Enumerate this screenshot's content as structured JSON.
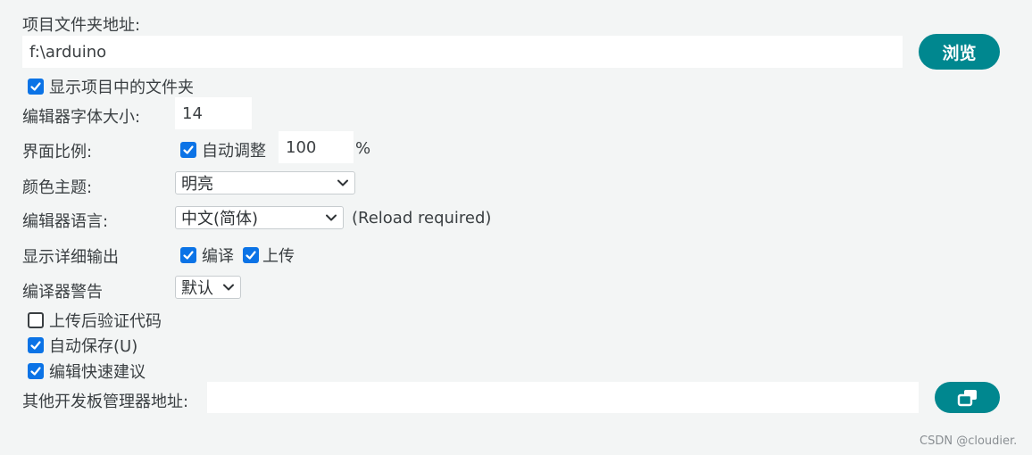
{
  "project_folder": {
    "label": "项目文件夹地址:",
    "value": "f:\\arduino",
    "browse_label": "浏览"
  },
  "show_project_folder": {
    "label": "显示项目中的文件夹",
    "checked": true
  },
  "font_size": {
    "label": "编辑器字体大小:",
    "value": "14"
  },
  "scale": {
    "label": "界面比例:",
    "auto_label": "自动调整",
    "auto_checked": true,
    "value": "100",
    "unit": "%"
  },
  "theme": {
    "label": "颜色主题:",
    "value": "明亮"
  },
  "language": {
    "label": "编辑器语言:",
    "value": "中文(简体)",
    "note": "(Reload required)"
  },
  "verbose": {
    "label": "显示详细输出",
    "compile_label": "编译",
    "compile_checked": true,
    "upload_label": "上传",
    "upload_checked": true
  },
  "compiler_warnings": {
    "label": "编译器警告",
    "value": "默认"
  },
  "verify_after_upload": {
    "label": "上传后验证代码",
    "checked": false
  },
  "auto_save": {
    "label": "自动保存(U)",
    "checked": true
  },
  "quick_suggestions": {
    "label": "编辑快速建议",
    "checked": true
  },
  "board_manager": {
    "label": "其他开发板管理器地址:",
    "value": ""
  },
  "watermark": "CSDN @cloudier.",
  "colors": {
    "accent": "#00878f",
    "checkbox": "#0b73e6",
    "background": "#f3f5f5"
  }
}
